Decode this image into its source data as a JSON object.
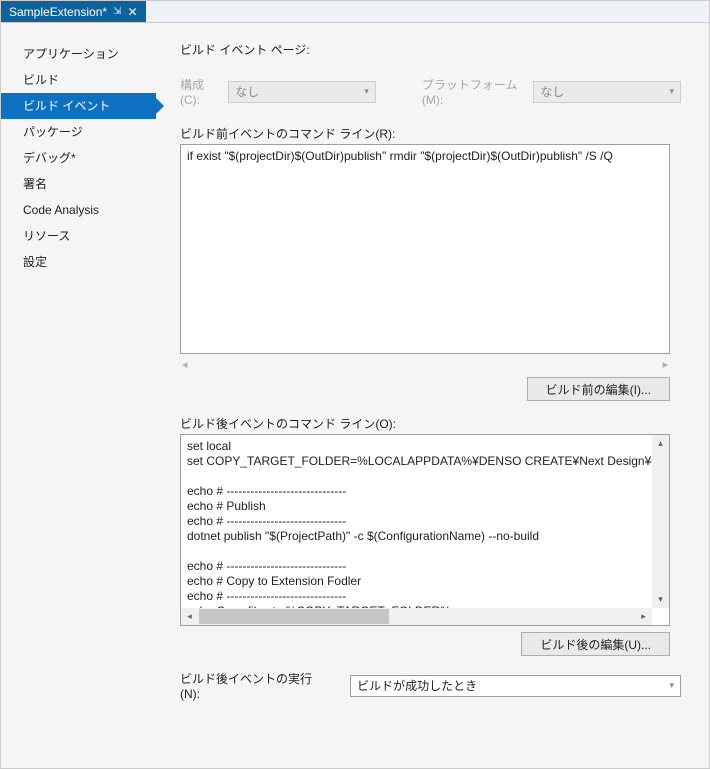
{
  "tab": {
    "title": "SampleExtension*"
  },
  "sidebar": {
    "items": [
      {
        "label": "アプリケーション"
      },
      {
        "label": "ビルド"
      },
      {
        "label": "ビルド イベント"
      },
      {
        "label": "パッケージ"
      },
      {
        "label": "デバッグ*"
      },
      {
        "label": "署名"
      },
      {
        "label": "Code Analysis"
      },
      {
        "label": "リソース"
      },
      {
        "label": "設定"
      }
    ]
  },
  "page": {
    "title": "ビルド イベント ページ:",
    "config_label": "構成(C):",
    "config_value": "なし",
    "platform_label": "プラットフォーム(M):",
    "platform_value": "なし",
    "prebuild_label": "ビルド前イベントのコマンド ライン(R):",
    "prebuild_text": "if exist \"$(projectDir)$(OutDir)publish\" rmdir \"$(projectDir)$(OutDir)publish\" /S /Q",
    "prebuild_edit_btn": "ビルド前の編集(I)...",
    "postbuild_label": "ビルド後イベントのコマンド ライン(O):",
    "postbuild_text": "set local\nset COPY_TARGET_FOLDER=%LOCALAPPDATA%¥DENSO CREATE¥Next Design¥extens\n\necho # ------------------------------\necho # Publish\necho # ------------------------------\ndotnet publish \"$(ProjectPath)\" -c $(ConfigurationName) --no-build\n\necho # ------------------------------\necho # Copy to Extension Fodler\necho # ------------------------------\necho Copy files to %COPY_TARGET_FOLDER% ...\n\nif exist \"%COPY_TARGET_FOLDER%\" rmdir \"%COPY_TARGET_FOLDER%\" /S /Q",
    "postbuild_edit_btn": "ビルド後の編集(U)...",
    "run_label": "ビルド後イベントの実行(N):",
    "run_value": "ビルドが成功したとき"
  }
}
